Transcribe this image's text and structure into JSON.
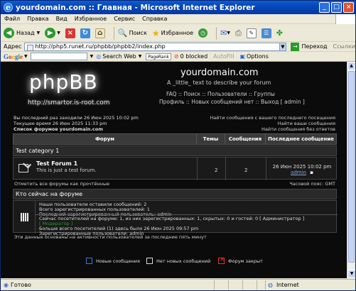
{
  "window": {
    "title": "yourdomain.com :: Главная - Microsoft Internet Explorer",
    "menu": [
      "Файл",
      "Правка",
      "Вид",
      "Избранное",
      "Сервис",
      "Справка"
    ]
  },
  "toolbar": {
    "back": "Назад",
    "search": "Поиск",
    "favorites": "Избранное"
  },
  "address": {
    "label": "Адрес",
    "url": "http://php5.runet.ru/phpbb/phpbb2/index.php",
    "go": "Переход",
    "links": "Ссылки"
  },
  "google": {
    "logo": "Google",
    "search_web": "Search Web",
    "pagerank": "PageRank",
    "blocked": "0 blocked",
    "autofill": "AutoFill",
    "options": "Options"
  },
  "forum": {
    "logo_text": "phpBB",
    "logo_url": "http://smartor.is-root.com",
    "site_name": "yourdomain.com",
    "site_desc": "A _little_ text to describe your forum",
    "nav1": "FAQ :: Поиск :: Пользователи :: Группы",
    "nav2": "Профиль :: Новых сообщений нет :: Выход [ admin ]",
    "last_visit": "Вы последний раз заходили 26 Июн 2025 10:02 pm",
    "current_time": "Текущее время 26 Июн 2025 11:33 pm",
    "forum_index": "Список форумов yourdomain.com",
    "search_new": "Найти сообщения с вашего последнего посещения",
    "search_yours": "Найти ваши сообщения",
    "search_unanswered": "Найти сообщения без ответов",
    "columns": [
      "Форум",
      "Темы",
      "Сообщения",
      "Последнее сообщение"
    ],
    "category": "Test category 1",
    "forum_name": "Test Forum 1",
    "forum_desc": "This is just a test forum.",
    "topics": "2",
    "posts": "2",
    "last_post_date": "26 Июн 2025 10:02 pm",
    "last_post_user": "admin",
    "mark_read": "Отметить все форумы как прочтённые",
    "timezone": "Часовой пояс: GMT",
    "who_online_title": "Кто сейчас на форуме",
    "who_line1": "Наши пользователи оставили сообщений: 2",
    "who_line2": "Всего зарегистрированных пользователей: 1",
    "who_line3": "Последний зарегистрированный пользователь: admin",
    "who_line4": "Сейчас посетителей на форуме: 1, из них зарегистрированных: 1, скрытых: 0 и гостей: 0   [ Администратор ]",
    "who_line5": "[ Модератор ]",
    "who_line6": "Больше всего посетителей (1) здесь было 26 Июн 2025 09:57 pm",
    "who_line7": "Зарегистрированные пользователи: admin",
    "note": "Эти данные основаны на активности пользователей за последние пять минут",
    "legend_new": "Новые сообщения",
    "legend_nonew": "Нет новых сообщений",
    "legend_closed": "Форум закрыт"
  },
  "status": {
    "left": "Готово",
    "zone": "Internet"
  }
}
